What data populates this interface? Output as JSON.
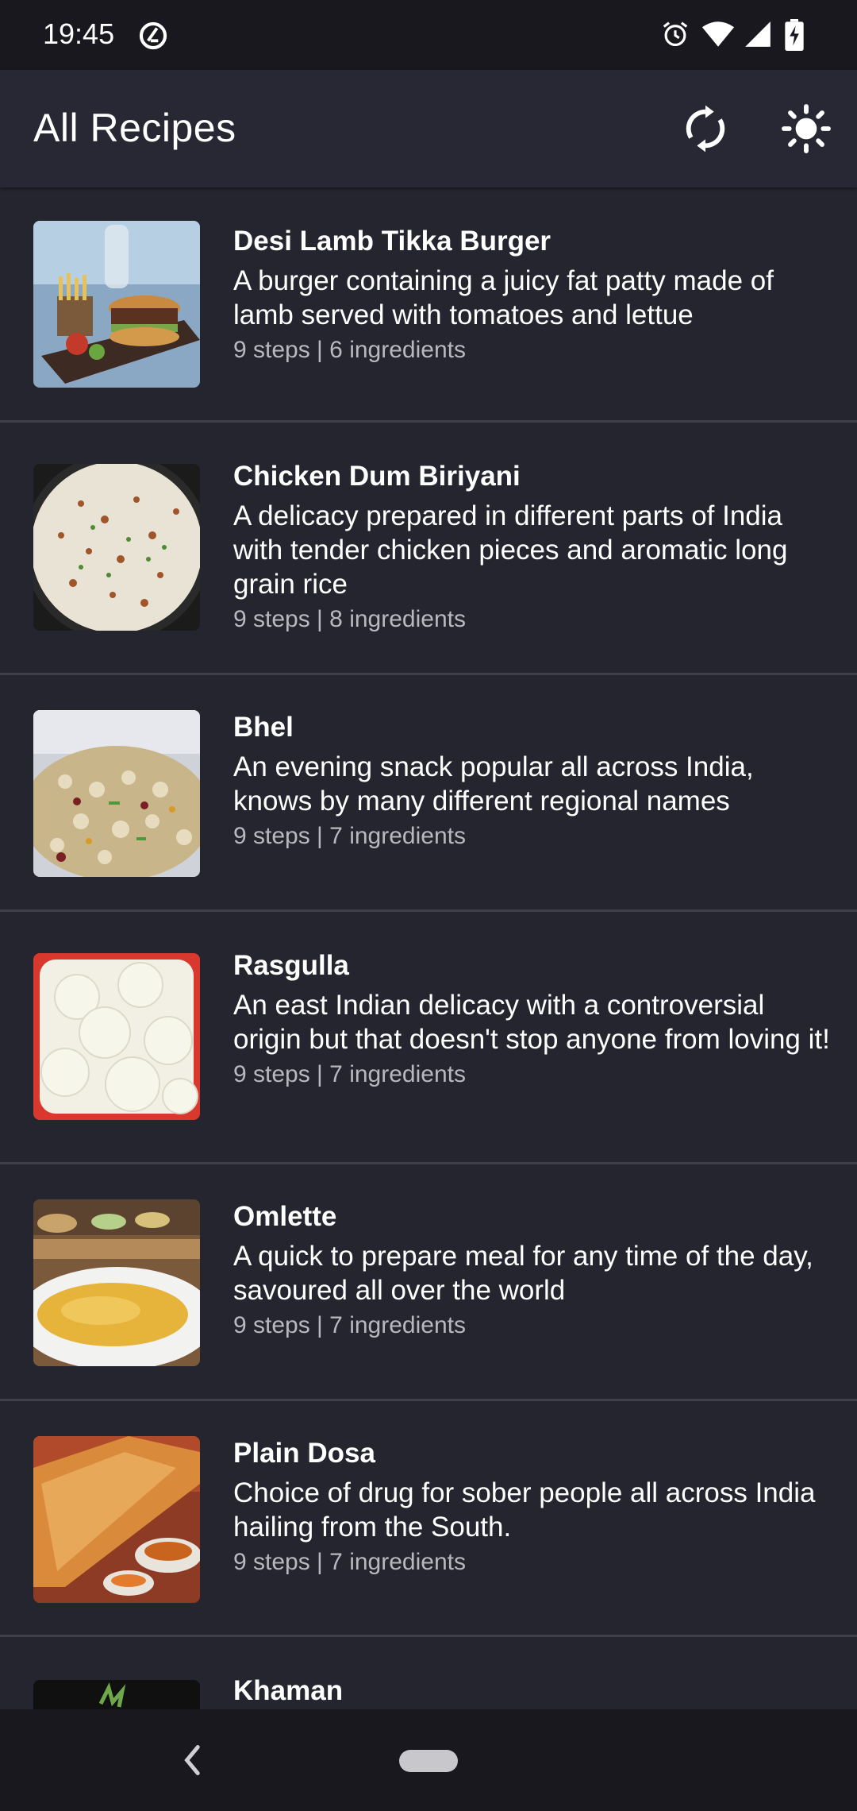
{
  "status_bar": {
    "time": "19:45",
    "left_icon": "at-sign-icon",
    "right_icons": [
      "alarm-icon",
      "wifi-icon",
      "signal-icon",
      "battery-charging-icon"
    ]
  },
  "app_bar": {
    "title": "All Recipes",
    "actions": [
      "refresh-icon",
      "brightness-icon"
    ]
  },
  "recipes": [
    {
      "title": "Desi Lamb Tikka Burger",
      "description": "A burger containing a juicy fat patty made of lamb served with tomatoes and lettue",
      "meta": "9 steps | 6 ingredients"
    },
    {
      "title": "Chicken Dum Biriyani",
      "description": "A delicacy prepared in different parts of India with tender chicken pieces and aromatic long grain rice",
      "meta": "9 steps | 8 ingredients"
    },
    {
      "title": "Bhel",
      "description": "An evening snack popular all across India, knows by many different regional names",
      "meta": "9 steps | 7 ingredients"
    },
    {
      "title": "Rasgulla",
      "description": "An east Indian delicacy with a controversial origin but that doesn't stop anyone from loving it!",
      "meta": "9 steps | 7 ingredients"
    },
    {
      "title": "Omlette",
      "description": "A quick to prepare meal for any time of the day, savoured all over the world",
      "meta": "9 steps | 7 ingredients"
    },
    {
      "title": "Plain Dosa",
      "description": "Choice of drug for sober people all across India hailing from the South.",
      "meta": "9 steps | 7 ingredients"
    },
    {
      "title": "Khaman",
      "description": "",
      "meta": ""
    }
  ],
  "nav_bar": {
    "icons": [
      "back-icon",
      "home-pill-icon"
    ]
  },
  "colors": {
    "background": "#24252f",
    "app_bar": "#272833",
    "status_bar": "#18181e",
    "divider": "#3e3f4a",
    "secondary_text": "#b8b9c0"
  }
}
